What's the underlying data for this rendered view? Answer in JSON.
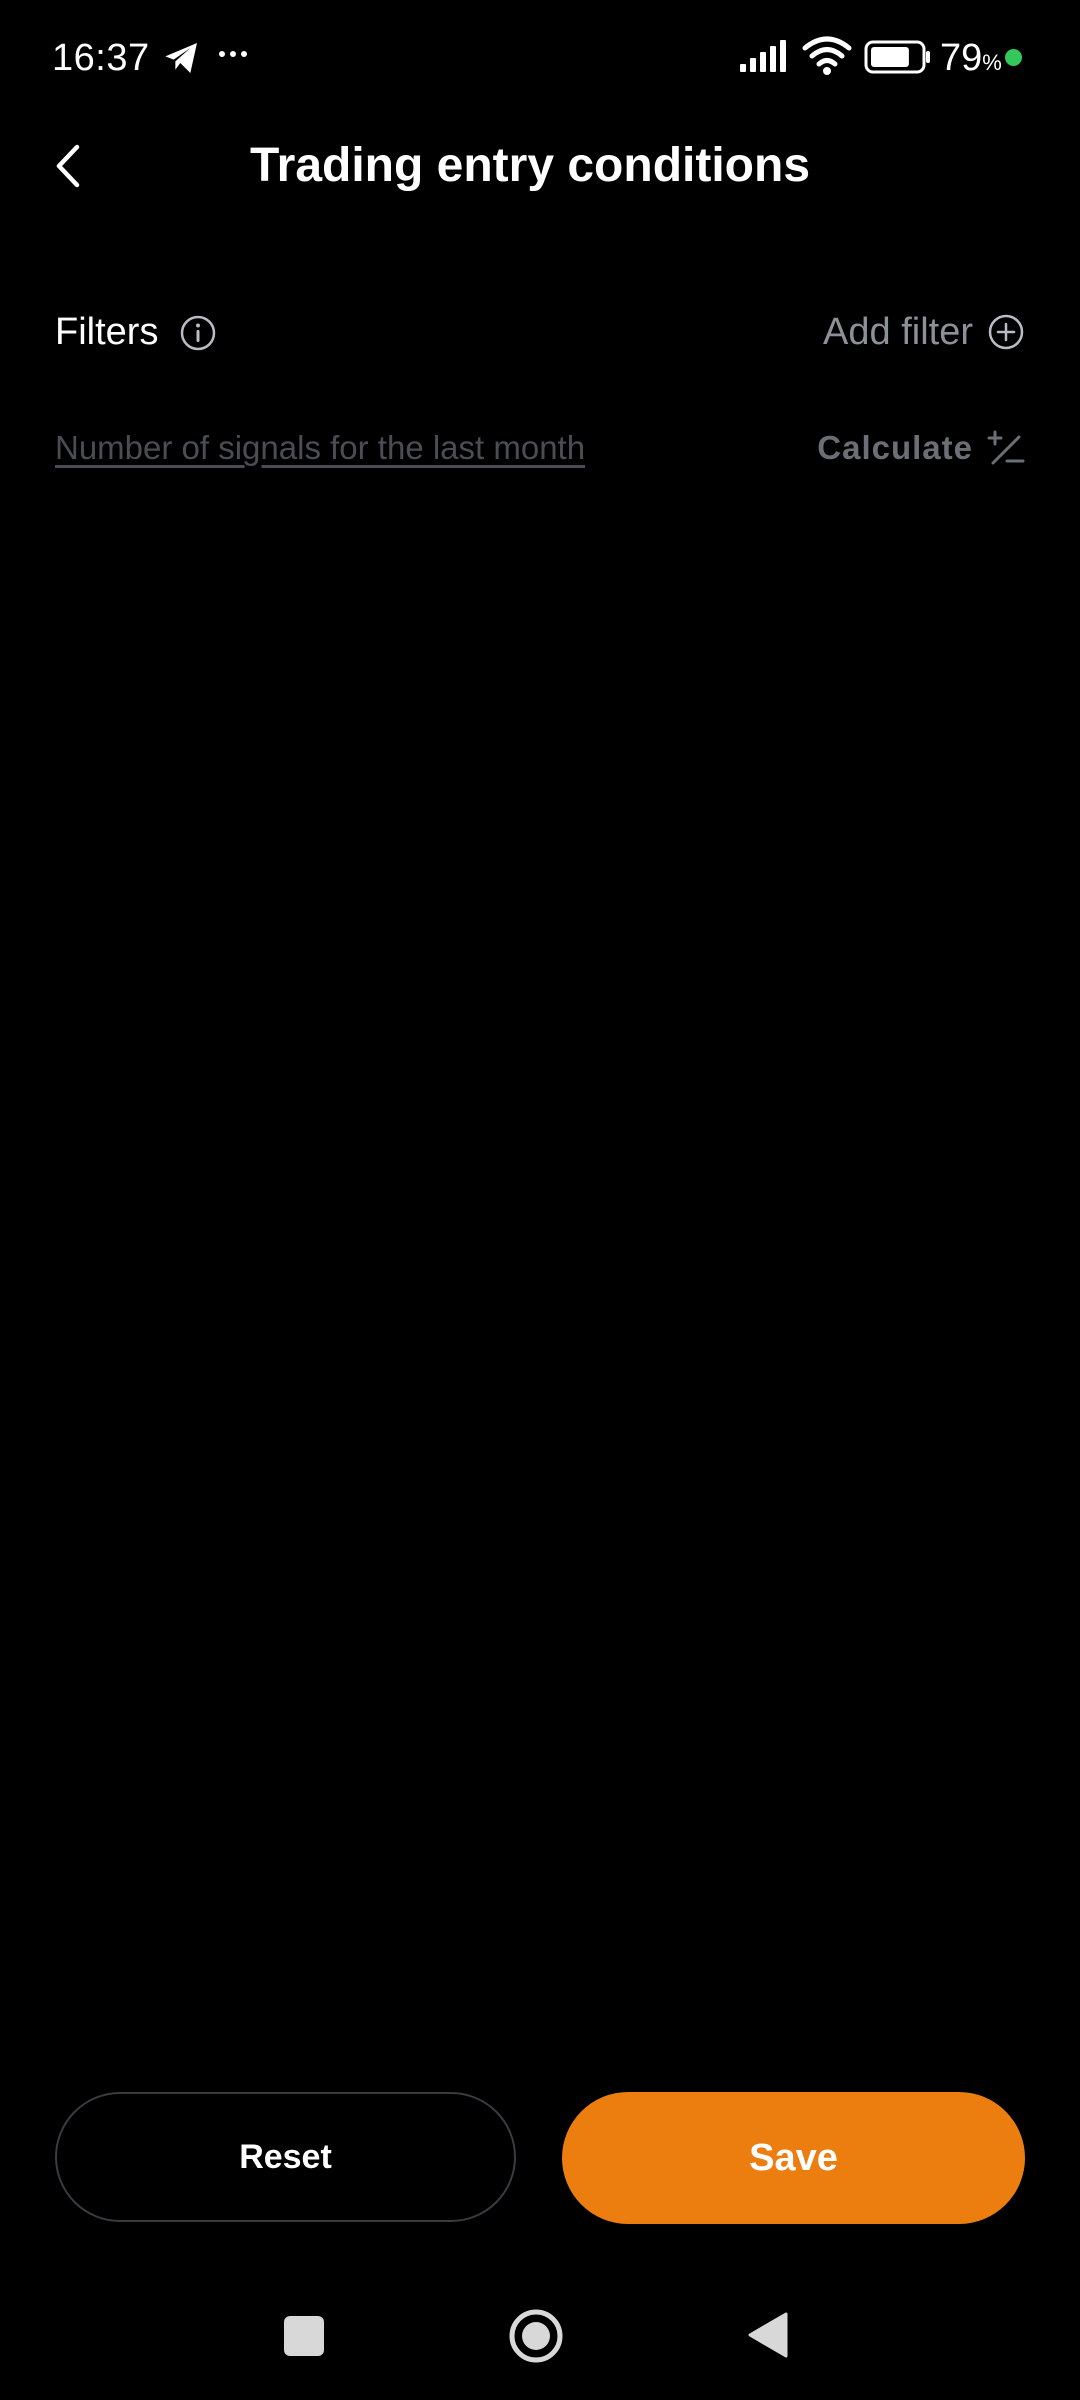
{
  "status_bar": {
    "time": "16:37",
    "battery_level": "79",
    "battery_unit": "%",
    "icons": [
      "telegram-icon",
      "more-dots-icon",
      "signal-icon",
      "wifi-icon",
      "battery-icon",
      "active-dot-icon"
    ],
    "battery_fill": 0.79
  },
  "header": {
    "title": "Trading entry conditions",
    "back_icon": "chevron-left-icon"
  },
  "filters": {
    "label": "Filters",
    "info_icon": "info-icon",
    "add_label": "Add filter",
    "add_icon": "plus-circle-icon"
  },
  "signals": {
    "link_label": "Number of signals for the last month",
    "calculate_label": "Calculate",
    "calculate_icon": "plus-minus-icon"
  },
  "actions": {
    "reset_label": "Reset",
    "save_label": "Save"
  },
  "nav": {
    "icons": [
      "recents-icon",
      "home-icon",
      "back-icon"
    ]
  },
  "colors": {
    "background": "#000000",
    "accent": "#ec7e0f",
    "muted_text": "#8c9098",
    "disabled_text": "#4a4d53",
    "status_dot": "#34c759"
  }
}
